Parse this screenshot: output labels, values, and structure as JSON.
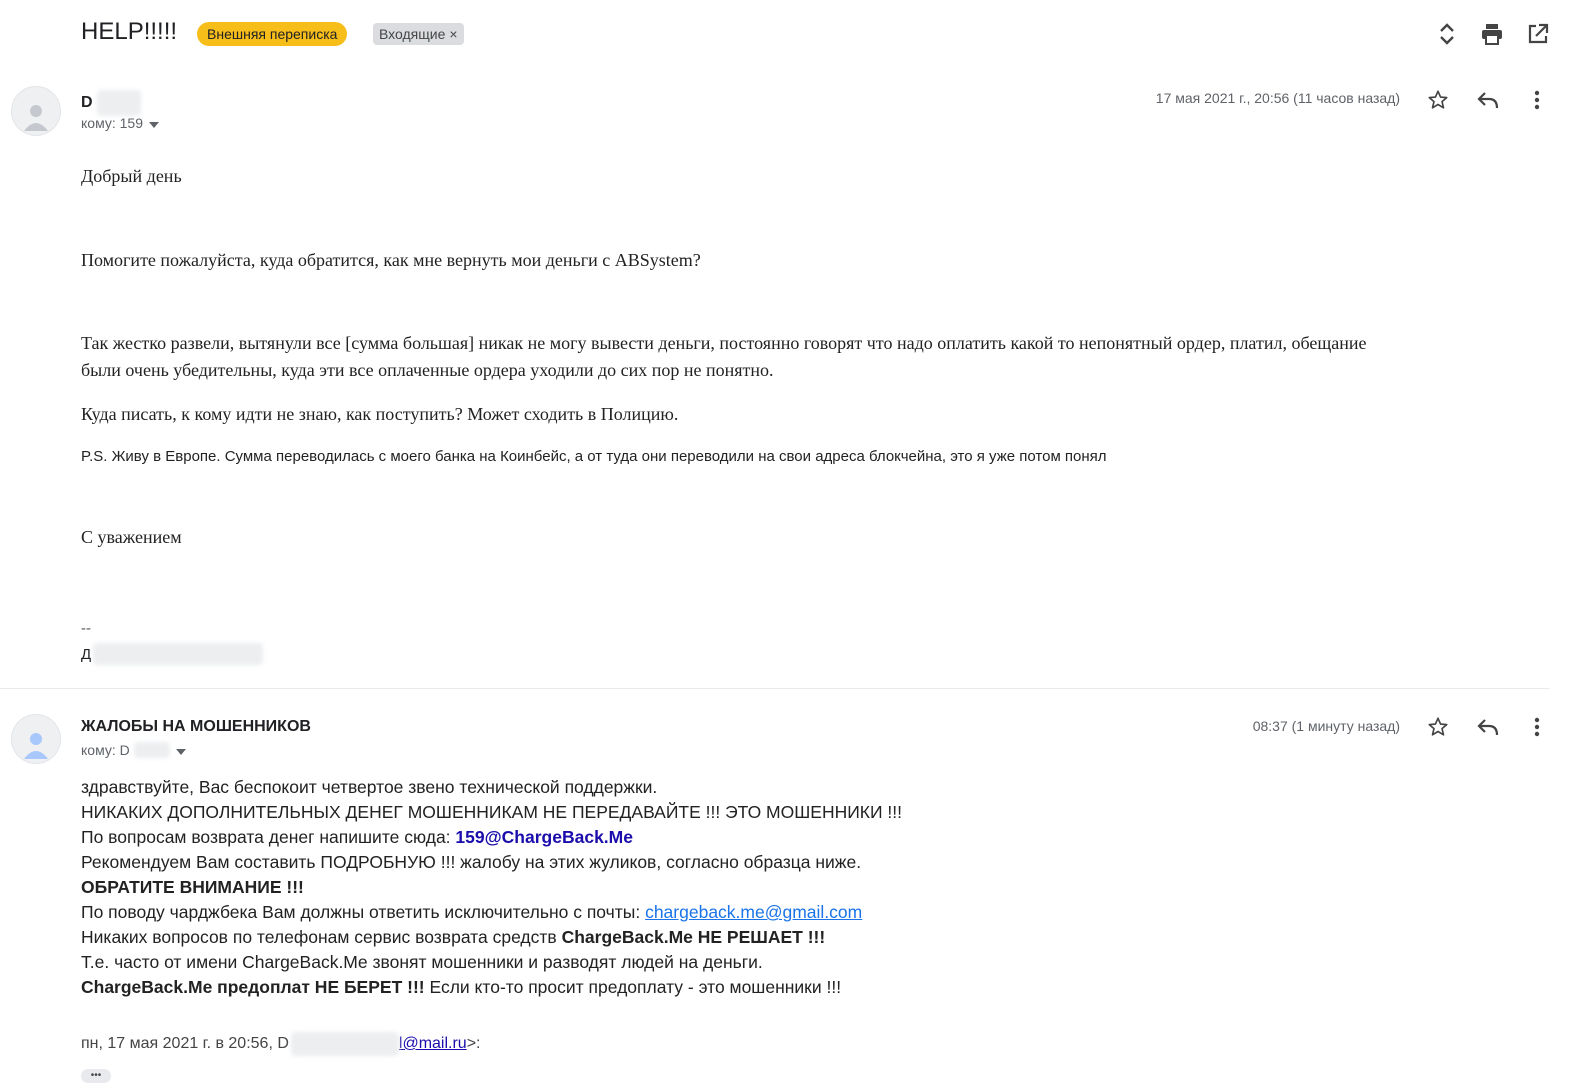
{
  "thread": {
    "subject": "HELP!!!!!",
    "labels": [
      {
        "text": "Внешняя переписка",
        "color": "#f7be1a"
      },
      {
        "text": "Входящие",
        "remove": "×"
      }
    ],
    "header_icons": [
      "expand-collapse-icon",
      "print-icon",
      "open-in-new-window-icon"
    ]
  },
  "message1": {
    "sender": "D",
    "to_label": "кому: 159",
    "date": "17 мая 2021 г., 20:56 (11 часов назад)",
    "icons": [
      "star-icon",
      "reply-icon",
      "more-vert-icon"
    ],
    "body": {
      "greeting": "Добрый день",
      "p1": "Помогите пожалуйста, куда обратится, как мне вернуть мои деньги с ABSystem?",
      "p2_line1": "Так жестко развели, вытянули все [сумма большая] никак не могу вывести деньги, постоянно говорят что надо оплатить какой то непонятный ордер, платил, обещание",
      "p2_line2": "были очень убедительны, куда эти все оплаченные ордера уходили до сих пор не понятно.",
      "p3": "Куда писать, к кому идти не знаю,  как поступить? Может сходить в Полицию.",
      "ps": "P.S. Живу в Европе. Сумма переводилась с моего банка на Коинбейс, а от туда они переводили на свои адреса блокчейна, это я уже потом понял",
      "closing": "С уважением",
      "sig_dash": "--",
      "sig_name": "Д"
    }
  },
  "message2": {
    "sender": "ЖАЛОБЫ НА МОШЕННИКОВ",
    "to_label": "кому: D",
    "date": "08:37 (1 минуту назад)",
    "icons": [
      "star-icon",
      "reply-icon",
      "more-vert-icon"
    ],
    "body": {
      "l1": "здравствуйте, Вас беспокоит четвертое звено технической поддержки.",
      "l2": "НИКАКИХ ДОПОЛНИТЕЛЬНЫХ ДЕНЕГ МОШЕННИКАМ НЕ ПЕРЕДАВАЙТЕ !!! ЭТО МОШЕННИКИ !!!",
      "l3_text": "По вопросам возврата денег напишите сюда: ",
      "l3_email": "159@ChargeBack.Me",
      "l4": "Рекомендуем Вам составить ПОДРОБНУЮ !!! жалобу на этих жуликов, согласно образца ниже.",
      "l5": "ОБРАТИТЕ ВНИМАНИЕ !!!",
      "l6_text": "По поводу чарджбека Вам должны ответить исключительно с почты: ",
      "l6_link": "chargeback.me@gmail.com",
      "l7_text": "Никаких вопросов по телефонам сервис возврата средств ",
      "l7_bold": "ChargeBack.Me НЕ РЕШАЕТ !!!",
      "l8": "Т.е. часто от имени ChargeBack.Me звонят мошенники и разводят людей на деньги.",
      "l9_bold": "ChargeBack.Me предоплат НЕ БЕРЕТ !!!",
      "l9_text": " Если кто-то просит предоплату - это мошенники !!!"
    },
    "quote": {
      "prefix": "пн, 17 мая 2021 г. в 20:56, D",
      "email_tail": "l@mail.ru",
      "suffix": ">:"
    },
    "show_trimmed": "•••"
  }
}
